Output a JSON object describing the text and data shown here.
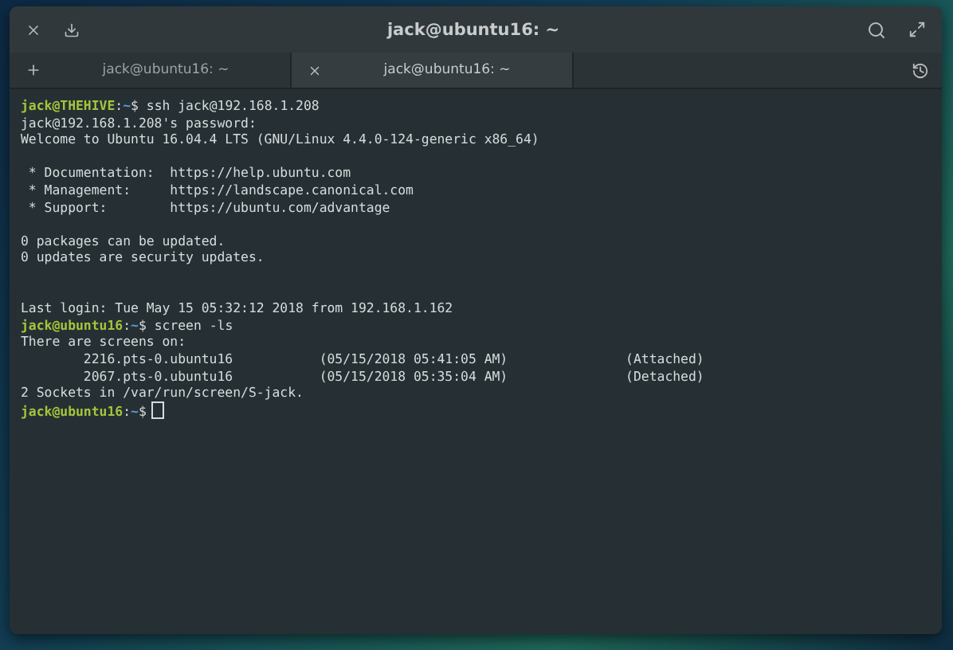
{
  "window": {
    "title": "jack@ubuntu16: ~"
  },
  "tabs": [
    {
      "label": "jack@ubuntu16: ~",
      "selected": false
    },
    {
      "label": "jack@ubuntu16: ~",
      "selected": true
    }
  ],
  "terminal": {
    "lines": [
      {
        "kind": "prompt",
        "user_host": "jack@THEHIVE",
        "separator": ":",
        "path": "~",
        "symbol": "$",
        "command": "ssh jack@192.168.1.208",
        "cursor": false
      },
      {
        "kind": "output",
        "text": "jack@192.168.1.208's password:"
      },
      {
        "kind": "output",
        "text": "Welcome to Ubuntu 16.04.4 LTS (GNU/Linux 4.4.0-124-generic x86_64)"
      },
      {
        "kind": "blank"
      },
      {
        "kind": "output",
        "text": " * Documentation:  https://help.ubuntu.com"
      },
      {
        "kind": "output",
        "text": " * Management:     https://landscape.canonical.com"
      },
      {
        "kind": "output",
        "text": " * Support:        https://ubuntu.com/advantage"
      },
      {
        "kind": "blank"
      },
      {
        "kind": "output",
        "text": "0 packages can be updated."
      },
      {
        "kind": "output",
        "text": "0 updates are security updates."
      },
      {
        "kind": "blank"
      },
      {
        "kind": "blank"
      },
      {
        "kind": "output",
        "text": "Last login: Tue May 15 05:32:12 2018 from 192.168.1.162"
      },
      {
        "kind": "prompt",
        "user_host": "jack@ubuntu16",
        "separator": ":",
        "path": "~",
        "symbol": "$",
        "command": "screen -ls",
        "cursor": false
      },
      {
        "kind": "output",
        "text": "There are screens on:"
      },
      {
        "kind": "output",
        "text": "        2216.pts-0.ubuntu16           (05/15/2018 05:41:05 AM)               (Attached)"
      },
      {
        "kind": "output",
        "text": "        2067.pts-0.ubuntu16           (05/15/2018 05:35:04 AM)               (Detached)"
      },
      {
        "kind": "output",
        "text": "2 Sockets in /var/run/screen/S-jack."
      },
      {
        "kind": "prompt",
        "user_host": "jack@ubuntu16",
        "separator": ":",
        "path": "~",
        "symbol": "$",
        "cursor": true
      }
    ]
  }
}
